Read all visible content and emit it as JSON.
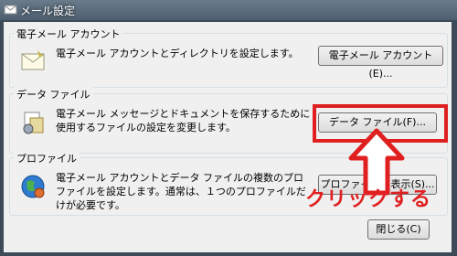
{
  "window": {
    "title": "メール設定"
  },
  "groups": {
    "account": {
      "label": "電子メール アカウント",
      "description": "電子メール アカウントとディレクトリを設定します。",
      "button": "電子メール アカウント(E)..."
    },
    "datafile": {
      "label": "データ ファイル",
      "description": "電子メール メッセージとドキュメントを保存するために使用するファイルの設定を変更します。",
      "button": "データ ファイル(F)..."
    },
    "profile": {
      "label": "プロファイル",
      "description": "電子メール アカウントとデータ ファイルの複数のプロファイルを設定します。通常は、１つのプロファイルだけが必要です。",
      "button": "プロファイルの表示(S)..."
    }
  },
  "footer": {
    "close_button": "閉じる(C)"
  },
  "annotation": {
    "text": "クリックする",
    "color": "#e02020"
  }
}
